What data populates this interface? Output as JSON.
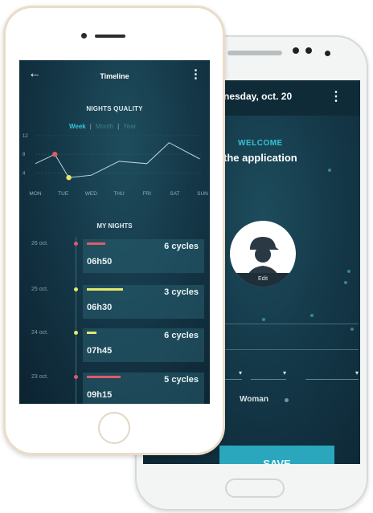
{
  "back_phone": {
    "date": "nesday, oct. 20",
    "welcome": "WELCOME",
    "app_text": "the application",
    "avatar_edit": "Edit",
    "gender_option": "Woman",
    "save_button": "SAVE",
    "accent_color": "#2aa7bd"
  },
  "front_phone": {
    "title": "Timeline",
    "nights_quality": "NIGHTS QUALITY",
    "tabs": [
      {
        "label": "Week",
        "active": true
      },
      {
        "label": "Month",
        "active": false
      },
      {
        "label": "Year",
        "active": false
      }
    ],
    "my_nights": "MY NIGHTS",
    "nights": [
      {
        "date": "26 oct.",
        "time": "06h50",
        "cycles": "6 cycles",
        "color": "#e05a69",
        "bar_fraction": 0.15
      },
      {
        "date": "25 oct.",
        "time": "06h30",
        "cycles": "3 cycles",
        "color": "#e6e86a",
        "bar_fraction": 0.3
      },
      {
        "date": "24 oct.",
        "time": "07h45",
        "cycles": "6 cycles",
        "color": "#e6e86a",
        "bar_fraction": 0.08
      },
      {
        "date": "23 oct.",
        "time": "09h15",
        "cycles": "5 cycles",
        "color": "#e05a69",
        "bar_fraction": 0.28
      }
    ]
  },
  "chart_data": {
    "type": "line",
    "categories": [
      "MON",
      "TUE",
      "WED",
      "THU",
      "FRI",
      "SAT",
      "SUN"
    ],
    "y_ticks": [
      "12",
      "8",
      "4"
    ],
    "ylim": [
      2,
      12
    ],
    "x": [
      0,
      0.7,
      1.2,
      2,
      3,
      4,
      4.8,
      5.9
    ],
    "values": [
      6,
      8,
      3,
      3.5,
      6.5,
      6,
      10.5,
      7
    ],
    "highlights": [
      {
        "index": 1,
        "color": "#e05a69"
      },
      {
        "index": 2,
        "color": "#e6e86a"
      }
    ],
    "line_color": "#b9d3da",
    "grid": true
  }
}
